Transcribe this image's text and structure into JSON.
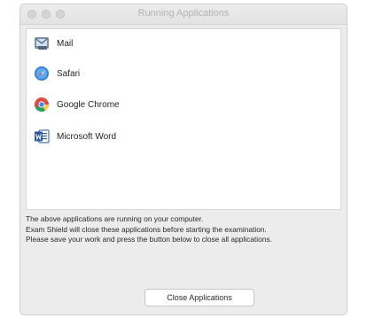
{
  "window": {
    "title": "Running Applications"
  },
  "apps": [
    {
      "label": "Mail",
      "icon": "mail-icon"
    },
    {
      "label": "Safari",
      "icon": "safari-icon"
    },
    {
      "label": "Google Chrome",
      "icon": "chrome-icon"
    },
    {
      "label": "Microsoft Word",
      "icon": "word-icon"
    }
  ],
  "message": {
    "line1": "The above applications are running on your computer.",
    "line2": "Exam Shield will close these applications before starting the examination.",
    "line3": "Please save your work and press the button below to close all applications."
  },
  "actions": {
    "close_label": "Close Applications"
  },
  "colors": {
    "window_bg": "#ececec",
    "list_bg": "#ffffff",
    "title_text": "#b2b2b2"
  }
}
